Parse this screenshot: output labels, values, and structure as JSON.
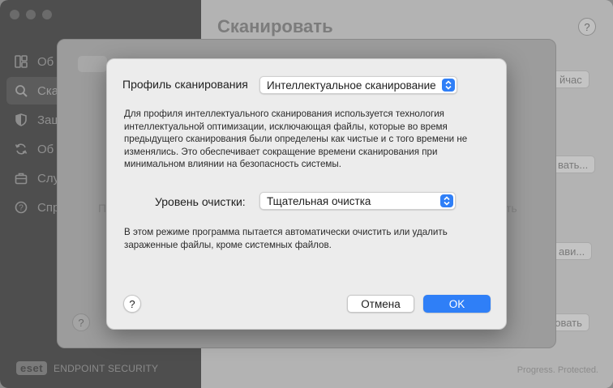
{
  "app": {
    "brand_logo": "eset",
    "brand_name": "ENDPOINT SECURITY",
    "footer": "Progress. Protected."
  },
  "sidebar": {
    "items": [
      {
        "label": "Об",
        "icon": "overview-icon"
      },
      {
        "label": "Ска",
        "icon": "search-icon",
        "active": true
      },
      {
        "label": "Защ",
        "icon": "shield-icon"
      },
      {
        "label": "Об",
        "icon": "refresh-icon"
      },
      {
        "label": "Слу",
        "icon": "briefcase-icon"
      },
      {
        "label": "Спр",
        "icon": "help-icon"
      }
    ]
  },
  "content": {
    "title": "Сканировать",
    "help": "?",
    "bg_button_1": "йчас",
    "bg_button_2": "вать...",
    "bg_button_3": "ави...",
    "bg_button_4": "ровать"
  },
  "sheet": {
    "help": "?",
    "faded_left": "П",
    "faded_right": "ть"
  },
  "dialog": {
    "profile_label": "Профиль сканирования",
    "profile_value": "Интеллектуальное сканирование",
    "profile_description": "Для профиля интеллектуального сканирования используется технология интеллектуальной оптимизации, исключающая файлы, которые во время предыдущего сканирования были определены как чистые и с того времени не изменялись. Это обеспечивает сокращение времени сканирования при минимальном влиянии на безопасность системы.",
    "clean_label": "Уровень очистки:",
    "clean_value": "Тщательная очистка",
    "clean_description": "В этом режиме программа пытается автоматически очистить или удалить зараженные файлы, кроме системных файлов.",
    "help": "?",
    "cancel": "Отмена",
    "ok": "OK"
  },
  "colors": {
    "accent": "#2f7ff7",
    "dialog_bg": "#ececec",
    "sidebar_bg": "#4e4e4e"
  }
}
